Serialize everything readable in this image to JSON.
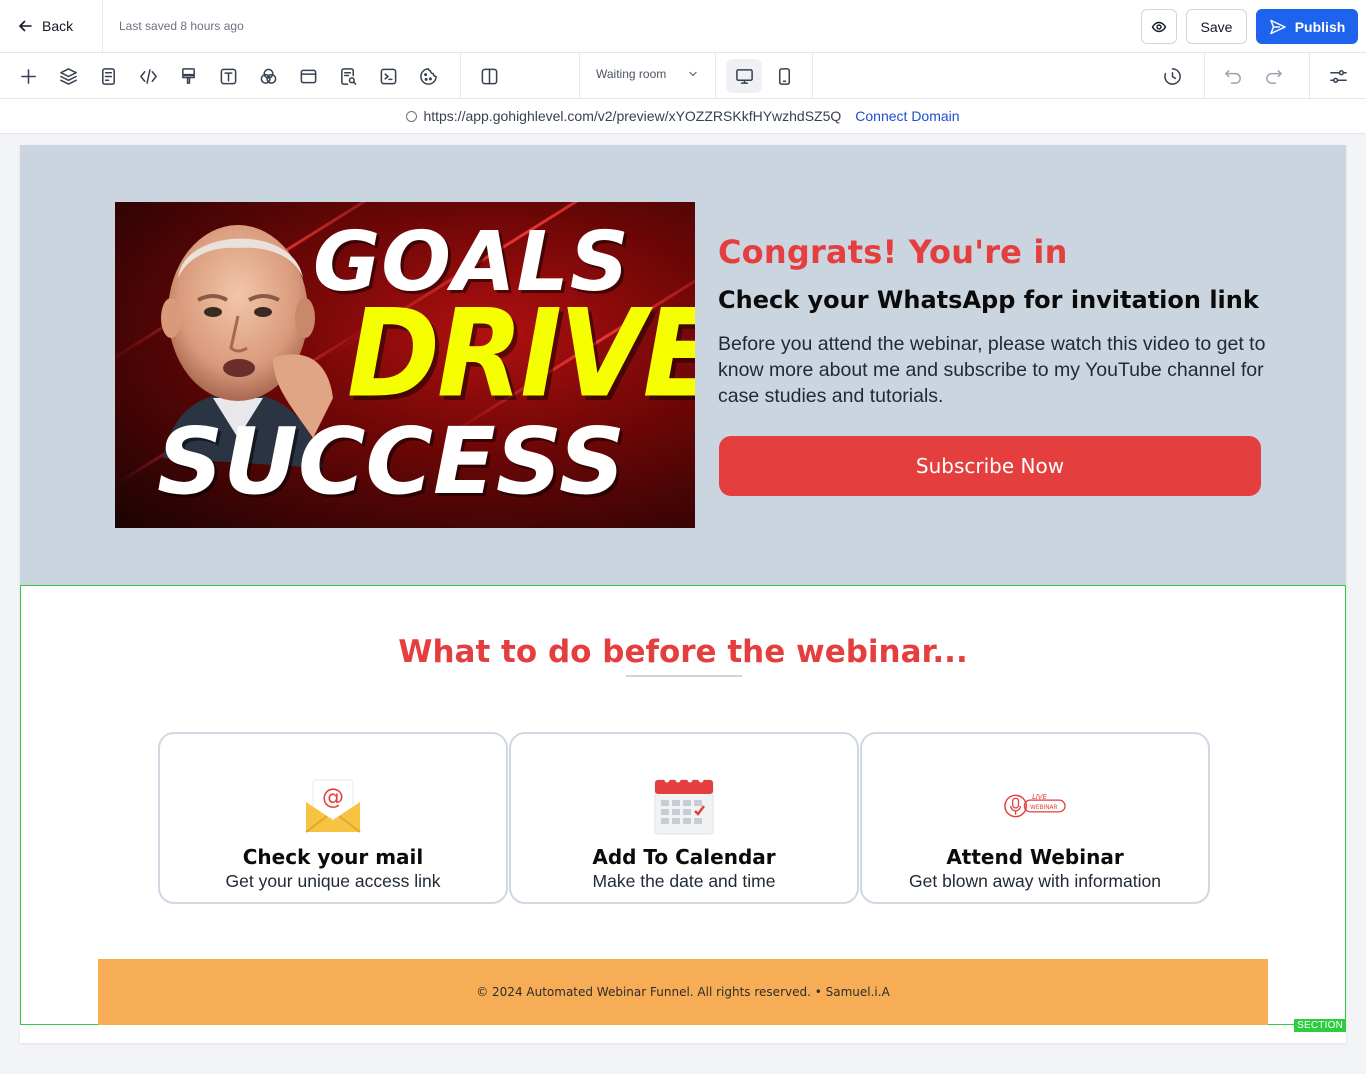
{
  "topbar": {
    "back_label": "Back",
    "last_saved": "Last saved 8 hours ago",
    "save_label": "Save",
    "publish_label": "Publish"
  },
  "toolbar": {
    "tools": [
      "plus-icon",
      "layers-icon",
      "page-icon",
      "code-icon",
      "paint-roller-icon",
      "text-icon",
      "color-circles-icon",
      "window-icon",
      "search-doc-icon",
      "terminal-icon",
      "cookie-icon",
      "columns-icon"
    ],
    "page_select": "Waiting room",
    "devices": [
      "desktop-icon",
      "mobile-icon"
    ],
    "active_device": "desktop"
  },
  "urlbar": {
    "url": "https://app.gohighlevel.com/v2/preview/xYOZZRSKkfHYwzhdSZ5Q",
    "connect_label": "Connect Domain"
  },
  "hero": {
    "thumbnail_words": [
      "GOALS",
      "DRIVE",
      "SUCCESS"
    ],
    "title": "Congrats! You're in",
    "subtitle": "Check your WhatsApp for invitation link",
    "body": "Before you attend the webinar, please watch this video to get to know more about me and subscribe to my YouTube channel for case studies and tutorials.",
    "button_label": "Subscribe Now"
  },
  "section": {
    "title": "What to do before the webinar...",
    "cards": [
      {
        "icon": "mail-icon",
        "title": "Check your mail",
        "desc": "Get your unique access link"
      },
      {
        "icon": "calendar-icon",
        "title": "Add To Calendar",
        "desc": "Make the date and time"
      },
      {
        "icon": "live-webinar-icon",
        "title": "Attend Webinar",
        "desc": "Get blown away with information",
        "icon_text_top": "LIVE",
        "icon_text_bottom": "WEBINAR"
      }
    ],
    "footer_text": "© 2024 Automated Webinar Funnel. All rights reserved. • Samuel.i.A",
    "badge": "SECTION"
  },
  "colors": {
    "accent_red": "#e53e3e",
    "publish_blue": "#1d63ed",
    "hero_bg": "#cbd5e0",
    "footer_orange": "#f6ad55",
    "section_border": "#2ecc40"
  }
}
